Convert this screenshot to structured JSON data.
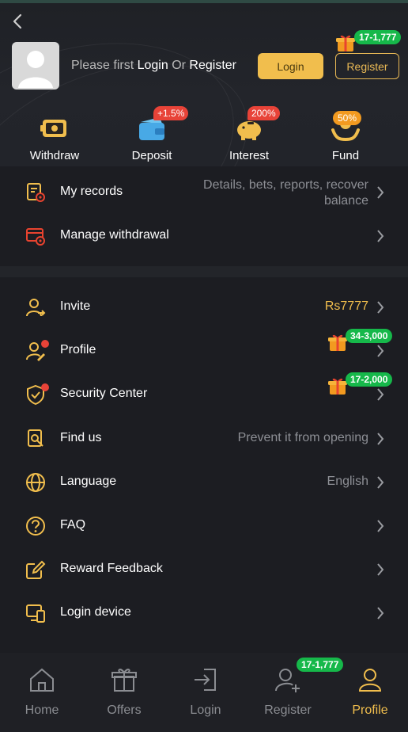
{
  "header": {
    "prompt_prefix": "Please first ",
    "prompt_login": "Login",
    "prompt_or": " Or ",
    "prompt_register": "Register",
    "login_button": "Login",
    "register_button": "Register",
    "register_bonus": "17-1,777"
  },
  "quick_actions": [
    {
      "label": "Withdraw",
      "icon": "withdraw-icon"
    },
    {
      "label": "Deposit",
      "icon": "wallet-icon",
      "badge": "+1.5%"
    },
    {
      "label": "Interest",
      "icon": "piggy-bank-icon",
      "badge": "200%"
    },
    {
      "label": "Fund",
      "icon": "fund-icon",
      "badge": "50%"
    }
  ],
  "menu_top": [
    {
      "label": "My records",
      "value_line1": "Details, bets, reports, recover",
      "value_line2": "balance",
      "icon": "records-icon"
    },
    {
      "label": "Manage withdrawal",
      "value": "",
      "icon": "withdrawal-card-icon"
    }
  ],
  "menu_main": [
    {
      "label": "Invite",
      "value": "Rs7777",
      "icon": "invite-user-icon"
    },
    {
      "label": "Profile",
      "value": "",
      "bonus": "34-3,000",
      "icon": "profile-edit-icon"
    },
    {
      "label": "Security Center",
      "value": "",
      "bonus": "17-2,000",
      "icon": "shield-check-icon"
    },
    {
      "label": "Find us",
      "value": "Prevent it from opening",
      "icon": "find-us-icon"
    },
    {
      "label": "Language",
      "value": "English",
      "icon": "globe-icon"
    },
    {
      "label": "FAQ",
      "value": "",
      "icon": "question-icon"
    },
    {
      "label": "Reward Feedback",
      "value": "",
      "icon": "feedback-edit-icon"
    },
    {
      "label": "Login device",
      "value": "",
      "icon": "devices-icon"
    }
  ],
  "bottom_nav": [
    {
      "label": "Home",
      "icon": "home-icon"
    },
    {
      "label": "Offers",
      "icon": "gift-icon"
    },
    {
      "label": "Login",
      "icon": "login-icon"
    },
    {
      "label": "Register",
      "icon": "add-user-icon",
      "bonus": "17-1,777"
    },
    {
      "label": "Profile",
      "icon": "profile-icon",
      "active": true
    }
  ],
  "colors": {
    "accent": "#f1be4d",
    "bonus_green": "#16b84a",
    "badge_red": "#e84338",
    "background": "#1c1d22"
  }
}
